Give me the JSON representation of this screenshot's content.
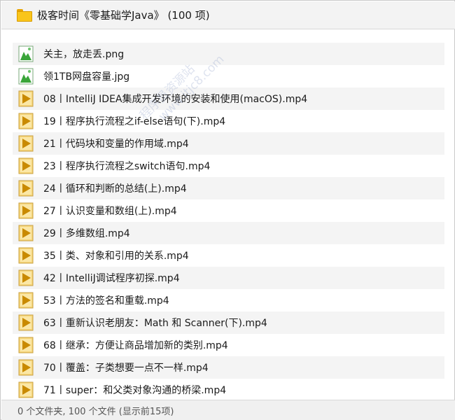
{
  "window": {
    "title": "极客时间《零基础学Java》 (100 项)"
  },
  "files": [
    {
      "name": "关主，放走丢.png",
      "icon": "image-file-icon"
    },
    {
      "name": "领1TB网盘容量.jpg",
      "icon": "image-file-icon"
    },
    {
      "name": "08丨IntelliJ IDEA集成开发环境的安装和使用(macOS).mp4",
      "icon": "video-file-icon"
    },
    {
      "name": "19丨程序执行流程之if-else语句(下).mp4",
      "icon": "video-file-icon"
    },
    {
      "name": "21丨代码块和变量的作用域.mp4",
      "icon": "video-file-icon"
    },
    {
      "name": "23丨程序执行流程之switch语句.mp4",
      "icon": "video-file-icon"
    },
    {
      "name": "24丨循环和判断的总结(上).mp4",
      "icon": "video-file-icon"
    },
    {
      "name": "27丨认识变量和数组(上).mp4",
      "icon": "video-file-icon"
    },
    {
      "name": "29丨多维数组.mp4",
      "icon": "video-file-icon"
    },
    {
      "name": "35丨类、对象和引用的关系.mp4",
      "icon": "video-file-icon"
    },
    {
      "name": "42丨IntelliJ调试程序初探.mp4",
      "icon": "video-file-icon"
    },
    {
      "name": "53丨方法的签名和重载.mp4",
      "icon": "video-file-icon"
    },
    {
      "name": "63丨重新认识老朋友：Math 和 Scanner(下).mp4",
      "icon": "video-file-icon"
    },
    {
      "name": "68丨继承：方便让商品增加新的类别.mp4",
      "icon": "video-file-icon"
    },
    {
      "name": "70丨覆盖：子类想要一点不一样.mp4",
      "icon": "video-file-icon"
    },
    {
      "name": "71丨super：和父类对象沟通的桥梁.mp4",
      "icon": "video-file-icon"
    }
  ],
  "status": {
    "text": "0 个文件夹, 100 个文件 (显示前15项)"
  },
  "watermark": {
    "line1": "程序员资源站",
    "line2": "www.itjc8.com"
  },
  "colors": {
    "folder": "#f9c51b",
    "video_icon_bg": "#f6d67a",
    "video_icon_arrow": "#c98a00",
    "image_icon_green": "#3aa53a"
  }
}
